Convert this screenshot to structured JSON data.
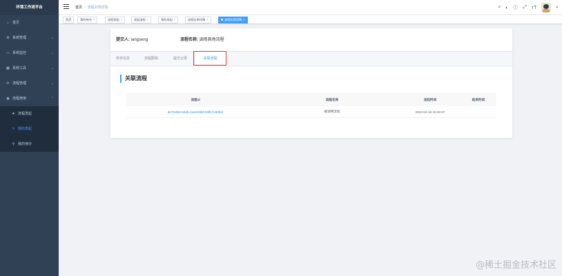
{
  "app": {
    "title": "环境工作流平台"
  },
  "sidebar": {
    "items": [
      {
        "label": "首页",
        "icon": "home-icon"
      },
      {
        "label": "系统管理",
        "icon": "gear-icon"
      },
      {
        "label": "系统监控",
        "icon": "monitor-icon"
      },
      {
        "label": "系统工具",
        "icon": "tool-icon"
      },
      {
        "label": "流程管理",
        "icon": "flow-icon"
      },
      {
        "label": "流程使用",
        "icon": "flow-use-icon"
      }
    ],
    "subitems": [
      {
        "label": "流程发起",
        "icon": "star-icon"
      },
      {
        "label": "我的发起",
        "icon": "edit-icon"
      },
      {
        "label": "我的待办",
        "icon": "user-icon"
      }
    ]
  },
  "navbar": {
    "breadcrumb": [
      "首页",
      "流程实例详情"
    ],
    "icons": [
      "search-icon",
      "github-icon",
      "help-icon",
      "fullscreen-icon",
      "font-size-icon",
      "avatar"
    ]
  },
  "tags": [
    "首页",
    "我的待办",
    "流程发起",
    "发起流程",
    "我的发起",
    "流程实例详情",
    "流程实例详情"
  ],
  "info": {
    "submitter_label": "提交人:",
    "submitter": "langseng",
    "process_label": "流程名称:",
    "process_name": "调用其他流程"
  },
  "tabs": [
    "表单信息",
    "流程跟踪",
    "提交记录",
    "关联流程"
  ],
  "section": {
    "title": "关联流程"
  },
  "table": {
    "headers": [
      "流程id",
      "流程名称",
      "发起时间",
      "结束时间"
    ],
    "rows": [
      {
        "id": "d470cf62-b048-11ed-83bf-00ff17c6091f",
        "name": "被调用流程",
        "start": "2023-02-19 19:30:37",
        "end": ""
      }
    ]
  },
  "watermark": "@稀土掘金技术社区",
  "colors": {
    "sidebar_bg": "#304156",
    "accent": "#409eff",
    "highlight": "#e53935"
  }
}
